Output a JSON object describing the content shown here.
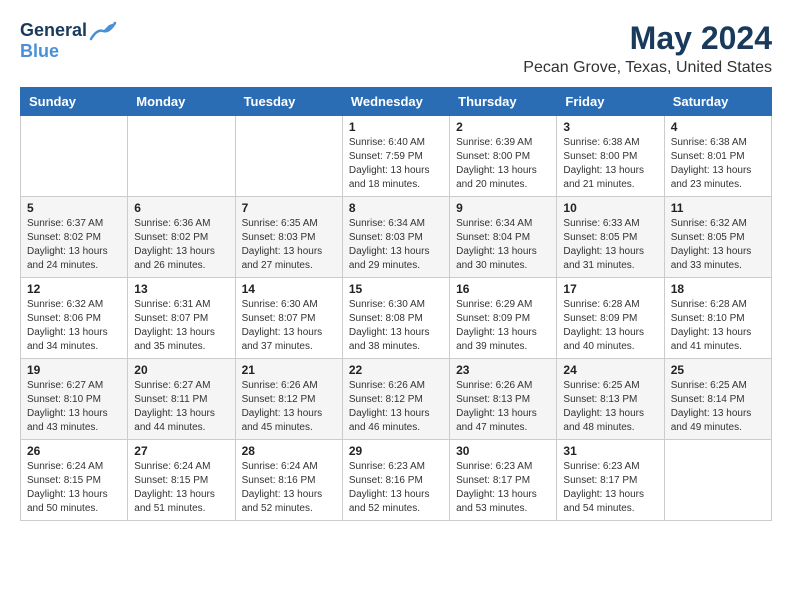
{
  "header": {
    "logo_line1": "General",
    "logo_line2": "Blue",
    "month": "May 2024",
    "location": "Pecan Grove, Texas, United States"
  },
  "weekdays": [
    "Sunday",
    "Monday",
    "Tuesday",
    "Wednesday",
    "Thursday",
    "Friday",
    "Saturday"
  ],
  "weeks": [
    [
      {
        "day": "",
        "info": ""
      },
      {
        "day": "",
        "info": ""
      },
      {
        "day": "",
        "info": ""
      },
      {
        "day": "1",
        "info": "Sunrise: 6:40 AM\nSunset: 7:59 PM\nDaylight: 13 hours\nand 18 minutes."
      },
      {
        "day": "2",
        "info": "Sunrise: 6:39 AM\nSunset: 8:00 PM\nDaylight: 13 hours\nand 20 minutes."
      },
      {
        "day": "3",
        "info": "Sunrise: 6:38 AM\nSunset: 8:00 PM\nDaylight: 13 hours\nand 21 minutes."
      },
      {
        "day": "4",
        "info": "Sunrise: 6:38 AM\nSunset: 8:01 PM\nDaylight: 13 hours\nand 23 minutes."
      }
    ],
    [
      {
        "day": "5",
        "info": "Sunrise: 6:37 AM\nSunset: 8:02 PM\nDaylight: 13 hours\nand 24 minutes."
      },
      {
        "day": "6",
        "info": "Sunrise: 6:36 AM\nSunset: 8:02 PM\nDaylight: 13 hours\nand 26 minutes."
      },
      {
        "day": "7",
        "info": "Sunrise: 6:35 AM\nSunset: 8:03 PM\nDaylight: 13 hours\nand 27 minutes."
      },
      {
        "day": "8",
        "info": "Sunrise: 6:34 AM\nSunset: 8:03 PM\nDaylight: 13 hours\nand 29 minutes."
      },
      {
        "day": "9",
        "info": "Sunrise: 6:34 AM\nSunset: 8:04 PM\nDaylight: 13 hours\nand 30 minutes."
      },
      {
        "day": "10",
        "info": "Sunrise: 6:33 AM\nSunset: 8:05 PM\nDaylight: 13 hours\nand 31 minutes."
      },
      {
        "day": "11",
        "info": "Sunrise: 6:32 AM\nSunset: 8:05 PM\nDaylight: 13 hours\nand 33 minutes."
      }
    ],
    [
      {
        "day": "12",
        "info": "Sunrise: 6:32 AM\nSunset: 8:06 PM\nDaylight: 13 hours\nand 34 minutes."
      },
      {
        "day": "13",
        "info": "Sunrise: 6:31 AM\nSunset: 8:07 PM\nDaylight: 13 hours\nand 35 minutes."
      },
      {
        "day": "14",
        "info": "Sunrise: 6:30 AM\nSunset: 8:07 PM\nDaylight: 13 hours\nand 37 minutes."
      },
      {
        "day": "15",
        "info": "Sunrise: 6:30 AM\nSunset: 8:08 PM\nDaylight: 13 hours\nand 38 minutes."
      },
      {
        "day": "16",
        "info": "Sunrise: 6:29 AM\nSunset: 8:09 PM\nDaylight: 13 hours\nand 39 minutes."
      },
      {
        "day": "17",
        "info": "Sunrise: 6:28 AM\nSunset: 8:09 PM\nDaylight: 13 hours\nand 40 minutes."
      },
      {
        "day": "18",
        "info": "Sunrise: 6:28 AM\nSunset: 8:10 PM\nDaylight: 13 hours\nand 41 minutes."
      }
    ],
    [
      {
        "day": "19",
        "info": "Sunrise: 6:27 AM\nSunset: 8:10 PM\nDaylight: 13 hours\nand 43 minutes."
      },
      {
        "day": "20",
        "info": "Sunrise: 6:27 AM\nSunset: 8:11 PM\nDaylight: 13 hours\nand 44 minutes."
      },
      {
        "day": "21",
        "info": "Sunrise: 6:26 AM\nSunset: 8:12 PM\nDaylight: 13 hours\nand 45 minutes."
      },
      {
        "day": "22",
        "info": "Sunrise: 6:26 AM\nSunset: 8:12 PM\nDaylight: 13 hours\nand 46 minutes."
      },
      {
        "day": "23",
        "info": "Sunrise: 6:26 AM\nSunset: 8:13 PM\nDaylight: 13 hours\nand 47 minutes."
      },
      {
        "day": "24",
        "info": "Sunrise: 6:25 AM\nSunset: 8:13 PM\nDaylight: 13 hours\nand 48 minutes."
      },
      {
        "day": "25",
        "info": "Sunrise: 6:25 AM\nSunset: 8:14 PM\nDaylight: 13 hours\nand 49 minutes."
      }
    ],
    [
      {
        "day": "26",
        "info": "Sunrise: 6:24 AM\nSunset: 8:15 PM\nDaylight: 13 hours\nand 50 minutes."
      },
      {
        "day": "27",
        "info": "Sunrise: 6:24 AM\nSunset: 8:15 PM\nDaylight: 13 hours\nand 51 minutes."
      },
      {
        "day": "28",
        "info": "Sunrise: 6:24 AM\nSunset: 8:16 PM\nDaylight: 13 hours\nand 52 minutes."
      },
      {
        "day": "29",
        "info": "Sunrise: 6:23 AM\nSunset: 8:16 PM\nDaylight: 13 hours\nand 52 minutes."
      },
      {
        "day": "30",
        "info": "Sunrise: 6:23 AM\nSunset: 8:17 PM\nDaylight: 13 hours\nand 53 minutes."
      },
      {
        "day": "31",
        "info": "Sunrise: 6:23 AM\nSunset: 8:17 PM\nDaylight: 13 hours\nand 54 minutes."
      },
      {
        "day": "",
        "info": ""
      }
    ]
  ]
}
